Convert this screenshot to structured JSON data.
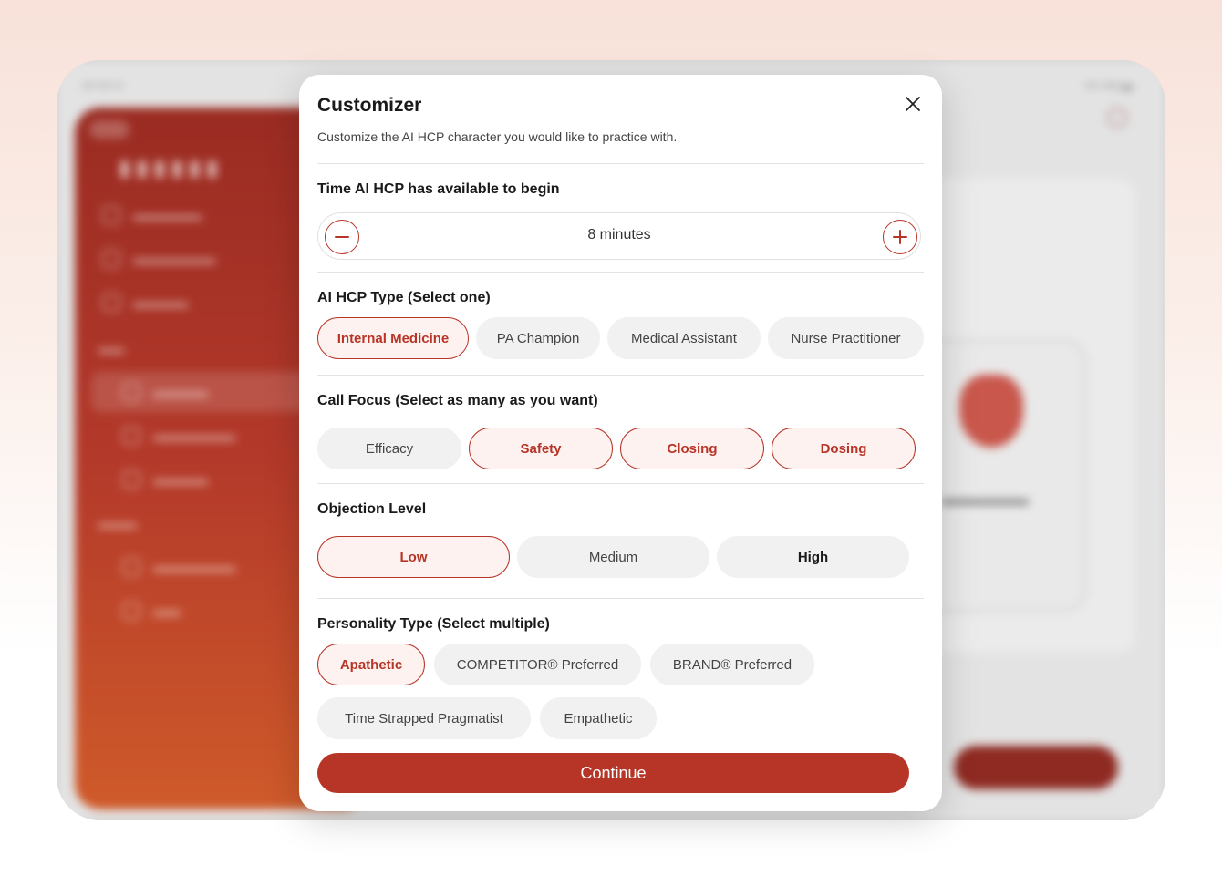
{
  "modal": {
    "title": "Customizer",
    "subtitle": "Customize the AI HCP character you would like to practice with.",
    "close_icon": "close-icon"
  },
  "time": {
    "label": "Time AI HCP has available to begin",
    "value": "8 minutes",
    "minus_icon": "minus-circle-icon",
    "plus_icon": "plus-circle-icon"
  },
  "hcp_type": {
    "label": "AI HCP Type (Select one)",
    "options": [
      {
        "label": "Internal Medicine",
        "selected": true
      },
      {
        "label": "PA Champion",
        "selected": false
      },
      {
        "label": "Medical Assistant",
        "selected": false
      },
      {
        "label": "Nurse Practitioner",
        "selected": false
      }
    ]
  },
  "call_focus": {
    "label": "Call Focus (Select as many as you want)",
    "options": [
      {
        "label": "Efficacy",
        "selected": false
      },
      {
        "label": "Safety",
        "selected": true
      },
      {
        "label": "Closing",
        "selected": true
      },
      {
        "label": "Dosing",
        "selected": true
      }
    ]
  },
  "objection": {
    "label": "Objection Level",
    "options": [
      {
        "label": "Low",
        "selected": true
      },
      {
        "label": "Medium",
        "selected": false
      },
      {
        "label": "High",
        "selected": false
      }
    ]
  },
  "personality": {
    "label": "Personality Type (Select multiple)",
    "options": [
      {
        "label": "Apathetic",
        "selected": true
      },
      {
        "label": "COMPETITOR® Preferred",
        "selected": false
      },
      {
        "label": "BRAND® Preferred",
        "selected": false
      },
      {
        "label": "Time Strapped Pragmatist",
        "selected": false
      },
      {
        "label": "Empathetic",
        "selected": false
      }
    ]
  },
  "continue_label": "Continue",
  "colors": {
    "accent": "#b73527",
    "selected_bg": "#fdf2f0",
    "chip_bg": "#f1f1f1"
  }
}
